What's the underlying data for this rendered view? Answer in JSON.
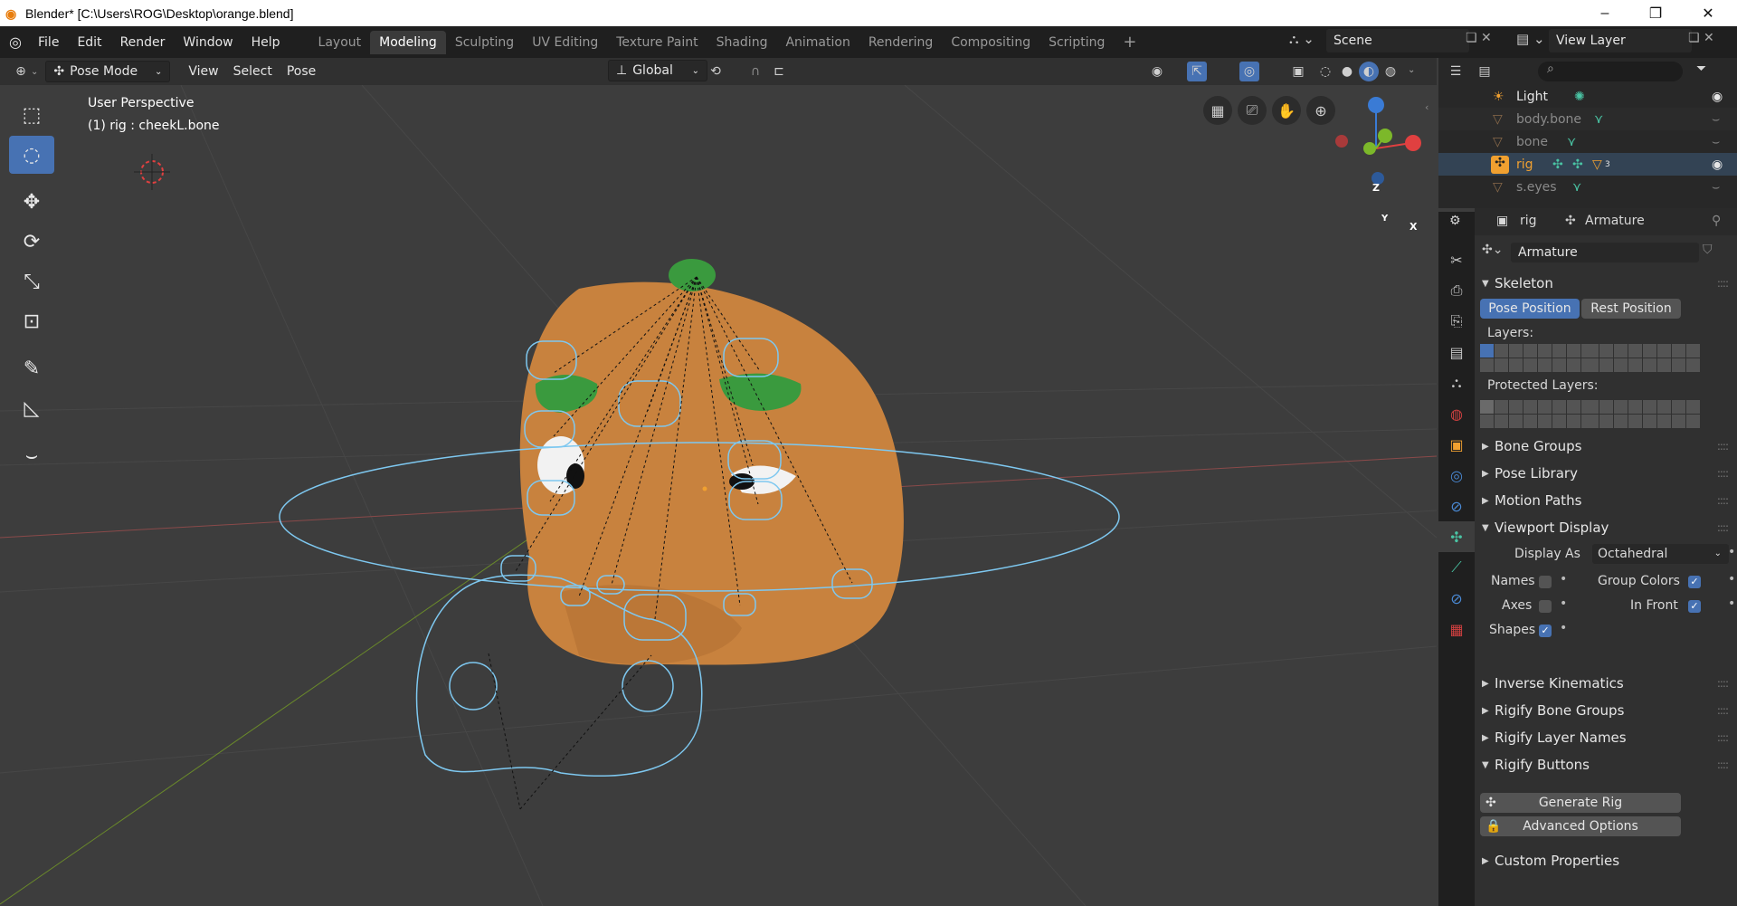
{
  "window": {
    "title": "Blender* [C:\\Users\\ROG\\Desktop\\orange.blend]",
    "minimize": "–",
    "restore": "❐",
    "close": "✕"
  },
  "menu": {
    "items": [
      "File",
      "Edit",
      "Render",
      "Window",
      "Help"
    ],
    "workspaces": [
      "Layout",
      "Modeling",
      "Sculpting",
      "UV Editing",
      "Texture Paint",
      "Shading",
      "Animation",
      "Rendering",
      "Compositing",
      "Scripting"
    ],
    "active_workspace": "Modeling",
    "add_workspace": "+",
    "scene_label": "Scene",
    "view_layer_label": "View Layer"
  },
  "viewport_header": {
    "mode": "Pose Mode",
    "menus": [
      "View",
      "Select",
      "Pose"
    ],
    "orientation": "Global"
  },
  "viewport": {
    "perspective_label": "User Perspective",
    "active_object_label": "(1) rig : cheekL.bone",
    "gizmo_axes": {
      "x": "X",
      "y": "Y",
      "z": "Z"
    }
  },
  "outliner": {
    "rows": [
      {
        "name": "Light",
        "icon": "light-icon",
        "color": "#c8c8c8"
      },
      {
        "name": "body.bone",
        "icon": "mesh-icon",
        "color": "#8a8a8a"
      },
      {
        "name": "bone",
        "icon": "mesh-icon",
        "color": "#8a8a8a"
      },
      {
        "name": "rig",
        "icon": "armature-icon",
        "color": "#f0a030",
        "badge": "3"
      },
      {
        "name": "s.eyes",
        "icon": "mesh-icon",
        "color": "#8a8a8a"
      }
    ]
  },
  "properties": {
    "breadcrumb_object": "rig",
    "breadcrumb_data": "Armature",
    "datablock_name": "Armature",
    "skeleton": {
      "title": "Skeleton",
      "pose_position": "Pose Position",
      "rest_position": "Rest Position",
      "layers_label": "Layers:",
      "protected_layers_label": "Protected Layers:"
    },
    "collapsed_panels_1": [
      "Bone Groups",
      "Pose Library",
      "Motion Paths"
    ],
    "viewport_display": {
      "title": "Viewport Display",
      "display_as_label": "Display As",
      "display_as_value": "Octahedral",
      "names_label": "Names",
      "axes_label": "Axes",
      "shapes_label": "Shapes",
      "group_colors_label": "Group Colors",
      "in_front_label": "In Front",
      "names_checked": false,
      "axes_checked": false,
      "shapes_checked": true,
      "group_colors_checked": true,
      "in_front_checked": true
    },
    "collapsed_panels_2": [
      "Inverse Kinematics",
      "Rigify Bone Groups",
      "Rigify Layer Names"
    ],
    "rigify_buttons": {
      "title": "Rigify Buttons",
      "generate_rig": "Generate Rig",
      "advanced_options": "Advanced Options"
    },
    "custom_properties": "Custom Properties"
  },
  "colors": {
    "accent": "#4772b3",
    "orange_body": "#c8823e",
    "bone_shape": "#7ec8f0",
    "green": "#3a9a3e"
  }
}
